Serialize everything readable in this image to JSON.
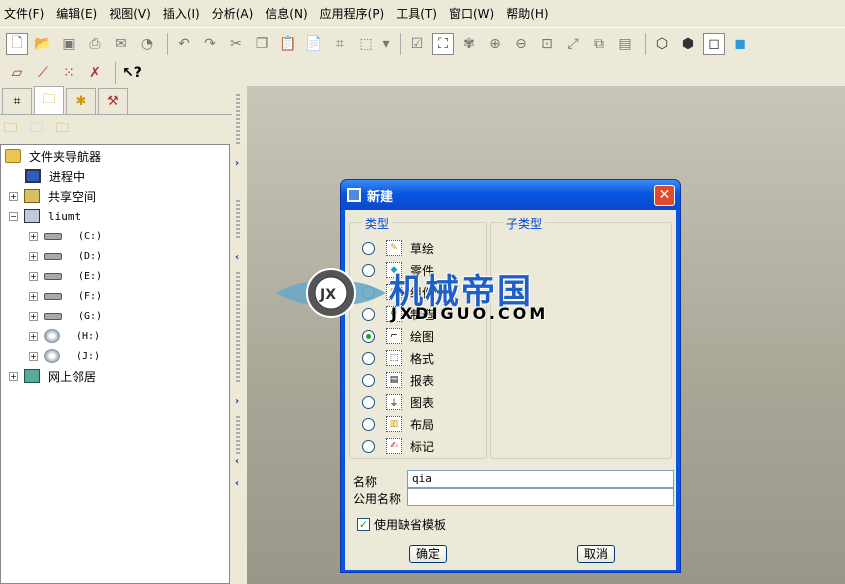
{
  "menu": [
    "文件(F)",
    "编辑(E)",
    "视图(V)",
    "插入(I)",
    "分析(A)",
    "信息(N)",
    "应用程序(P)",
    "工具(T)",
    "窗口(W)",
    "帮助(H)"
  ],
  "navigator": {
    "tree": [
      {
        "label": "文件夹导航器",
        "icon": "folder-navigator-icon"
      },
      {
        "label": "进程中",
        "icon": "monitor-icon"
      },
      {
        "label": "共享空间",
        "icon": "share-folder-icon"
      },
      {
        "label": "liumt",
        "icon": "computer-icon"
      },
      {
        "label": "(C:)",
        "icon": "drive-icon"
      },
      {
        "label": "(D:)",
        "icon": "drive-icon"
      },
      {
        "label": "(E:)",
        "icon": "drive-icon"
      },
      {
        "label": "(F:)",
        "icon": "drive-icon"
      },
      {
        "label": "(G:)",
        "icon": "drive-icon"
      },
      {
        "label": "(H:)",
        "icon": "cd-drive-icon"
      },
      {
        "label": "(J:)",
        "icon": "cd-drive-icon"
      },
      {
        "label": "网上邻居",
        "icon": "network-icon"
      }
    ]
  },
  "dialog": {
    "title": "新建",
    "close": "✕",
    "type_group": "类型",
    "subtype_group": "子类型",
    "types": [
      "草绘",
      "零件",
      "组件",
      "制造",
      "绘图",
      "格式",
      "报表",
      "图表",
      "布局",
      "标记"
    ],
    "selected_type": "绘图",
    "name_label": "名称",
    "name_value": "qia",
    "common_name_label": "公用名称",
    "common_name_value": "",
    "use_template_label": "使用缺省模板",
    "use_template_checked": true,
    "ok": "确定",
    "cancel": "取消"
  },
  "watermark": {
    "cn": "机械帝国",
    "en": "JXDIGUO.COM",
    "logo": "JX"
  }
}
